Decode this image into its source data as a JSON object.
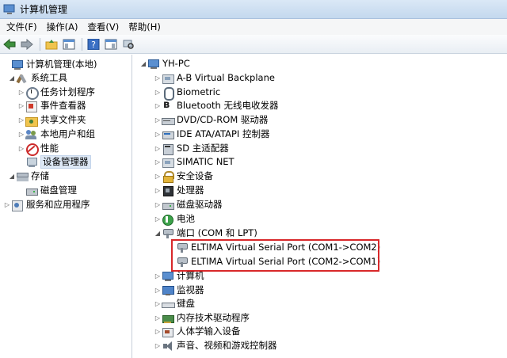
{
  "window": {
    "title": "计算机管理"
  },
  "menu": [
    {
      "label": "文件(F)"
    },
    {
      "label": "操作(A)"
    },
    {
      "label": "查看(V)"
    },
    {
      "label": "帮助(H)"
    }
  ],
  "toolbar": {
    "buttons": [
      "back-arrow-icon",
      "forward-arrow-icon",
      "up-folder-icon",
      "show-hide-tree-icon",
      "help-icon",
      "properties-icon",
      "device-scan-icon"
    ]
  },
  "left_tree": [
    {
      "label": "计算机管理(本地)",
      "icon": "computer-icon",
      "arrow": "",
      "indent": 0
    },
    {
      "label": "系统工具",
      "icon": "tools-icon",
      "arrow": "◢",
      "indent": 1
    },
    {
      "label": "任务计划程序",
      "icon": "clock-icon",
      "arrow": "▷",
      "indent": 2
    },
    {
      "label": "事件查看器",
      "icon": "event-viewer-icon",
      "arrow": "▷",
      "indent": 2
    },
    {
      "label": "共享文件夹",
      "icon": "shared-folder-icon",
      "arrow": "▷",
      "indent": 2
    },
    {
      "label": "本地用户和组",
      "icon": "users-icon",
      "arrow": "▷",
      "indent": 2
    },
    {
      "label": "性能",
      "icon": "performance-icon",
      "arrow": "▷",
      "indent": 2
    },
    {
      "label": "设备管理器",
      "icon": "device-manager-icon",
      "arrow": "",
      "indent": 2,
      "selected": true
    },
    {
      "label": "存储",
      "icon": "storage-icon",
      "arrow": "◢",
      "indent": 1
    },
    {
      "label": "磁盘管理",
      "icon": "disk-icon",
      "arrow": "",
      "indent": 2
    },
    {
      "label": "服务和应用程序",
      "icon": "services-icon",
      "arrow": "▷",
      "indent": 1
    }
  ],
  "right_tree": [
    {
      "label": "YH-PC",
      "icon": "computer-icon",
      "arrow": "◢",
      "indent": 0
    },
    {
      "label": "A-B Virtual Backplane",
      "icon": "generic-device-icon",
      "arrow": "▷",
      "indent": 1
    },
    {
      "label": "Biometric",
      "icon": "fingerprint-icon",
      "arrow": "▷",
      "indent": 1
    },
    {
      "label": "Bluetooth 无线电收发器",
      "icon": "bluetooth-icon",
      "arrow": "▷",
      "indent": 1
    },
    {
      "label": "DVD/CD-ROM 驱动器",
      "icon": "dvd-drive-icon",
      "arrow": "▷",
      "indent": 1
    },
    {
      "label": "IDE ATA/ATAPI 控制器",
      "icon": "ide-controller-icon",
      "arrow": "▷",
      "indent": 1
    },
    {
      "label": "SD 主适配器",
      "icon": "sd-card-icon",
      "arrow": "▷",
      "indent": 1
    },
    {
      "label": "SIMATIC NET",
      "icon": "generic-device-icon",
      "arrow": "▷",
      "indent": 1
    },
    {
      "label": "安全设备",
      "icon": "security-lock-icon",
      "arrow": "▷",
      "indent": 1
    },
    {
      "label": "处理器",
      "icon": "processor-icon",
      "arrow": "▷",
      "indent": 1
    },
    {
      "label": "磁盘驱动器",
      "icon": "disk-icon",
      "arrow": "▷",
      "indent": 1
    },
    {
      "label": "电池",
      "icon": "battery-icon",
      "arrow": "▷",
      "indent": 1
    },
    {
      "label": "端口 (COM 和 LPT)",
      "icon": "port-icon",
      "arrow": "◢",
      "indent": 1
    },
    {
      "label": "ELTIMA Virtual Serial Port (COM1->COM2)",
      "icon": "port-icon",
      "arrow": "",
      "indent": 2
    },
    {
      "label": "ELTIMA Virtual Serial Port (COM2->COM1)",
      "icon": "port-icon",
      "arrow": "",
      "indent": 2
    },
    {
      "label": "计算机",
      "icon": "computer-icon",
      "arrow": "▷",
      "indent": 1
    },
    {
      "label": "监视器",
      "icon": "monitor-icon",
      "arrow": "▷",
      "indent": 1
    },
    {
      "label": "键盘",
      "icon": "keyboard-icon",
      "arrow": "▷",
      "indent": 1
    },
    {
      "label": "内存技术驱动程序",
      "icon": "memory-icon",
      "arrow": "▷",
      "indent": 1
    },
    {
      "label": "人体学输入设备",
      "icon": "hid-icon",
      "arrow": "▷",
      "indent": 1
    },
    {
      "label": "声音、视频和游戏控制器",
      "icon": "audio-icon",
      "arrow": "▷",
      "indent": 1
    }
  ],
  "colors": {
    "highlight_box": "#d8282a",
    "selection": "#dde8f5"
  }
}
